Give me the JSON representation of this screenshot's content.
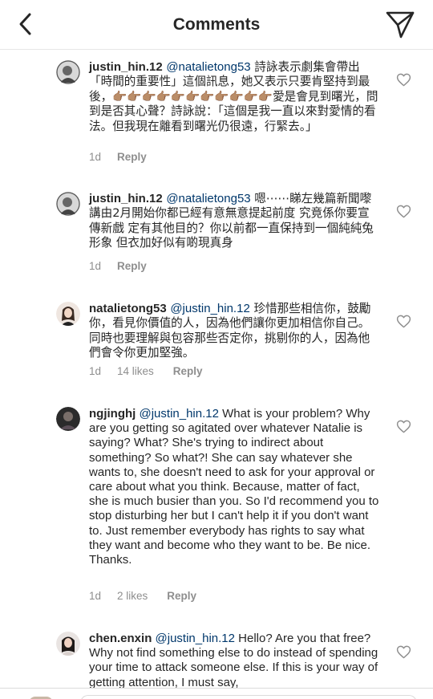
{
  "header": {
    "title": "Comments",
    "back_icon": "chevron-left-icon",
    "send_icon": "paper-plane-icon"
  },
  "comments": [
    {
      "username": "justin_hin.12",
      "mention": "@natalietong53",
      "text": "詩詠表示劇集會帶出「時間的重要性」這個訊息，她又表示只要肯堅持到最後，👉🏽👉🏽👉🏽👉🏽👉🏽👉🏽👉🏽👉🏽👉🏽👉🏽👉🏽愛是會見到曙光，問到是否其心聲？詩詠說：「這個是我一直以來對愛情的看法。但我現在離看到曙光仍很遠，行緊去。」",
      "time": "1d",
      "likes": "",
      "reply": "Reply"
    },
    {
      "username": "justin_hin.12",
      "mention": "@natalietong53",
      "text": "嗯⋯⋯睇左幾篇新聞嚟講由2月開始你都已經有意無意提起前度 究竟係你要宣傳新戲 定有其他目的？你以前都一直保持到一個純純兔形象 但衣加好似有啲現真身",
      "time": "1d",
      "likes": "",
      "reply": "Reply"
    },
    {
      "username": "natalietong53",
      "mention": "@justin_hin.12",
      "text": "珍惜那些相信你，鼓勵你，看見你價值的人，因為他們讓你更加相信你自己。同時也要理解與包容那些否定你，挑剔你的人，因為他們會令你更加堅強。",
      "time": "1d",
      "likes": "14 likes",
      "reply": "Reply"
    },
    {
      "username": "ngjinghj",
      "mention": "@justin_hin.12",
      "text": "What is your problem? Why are you getting so agitated over whatever Natalie is saying? What? She's trying to indirect about something? So what?! She can say whatever she wants to, she doesn't need to ask for your approval or care about what you think. Because, matter of fact, she is much busier than you. So I'd recommend you to stop disturbing her but I can't help it if you don't want to. Just remember everybody has rights to say what they want and become who they want to be. Be nice. Thanks.",
      "time": "1d",
      "likes": "2 likes",
      "reply": "Reply"
    },
    {
      "username": "chen.enxin",
      "mention": "@justin_hin.12",
      "text": "Hello? Are you that free? Why not find something else to do instead of spending your time to attack someone else. If this is your way of getting attention, I must say,",
      "time": "",
      "likes": "",
      "reply": ""
    }
  ],
  "colors": {
    "text": "#262626",
    "mention": "#00376b",
    "meta": "#8e8e8e",
    "divider": "#dbdbdb"
  },
  "icons": {
    "like": "heart-outline-icon"
  }
}
